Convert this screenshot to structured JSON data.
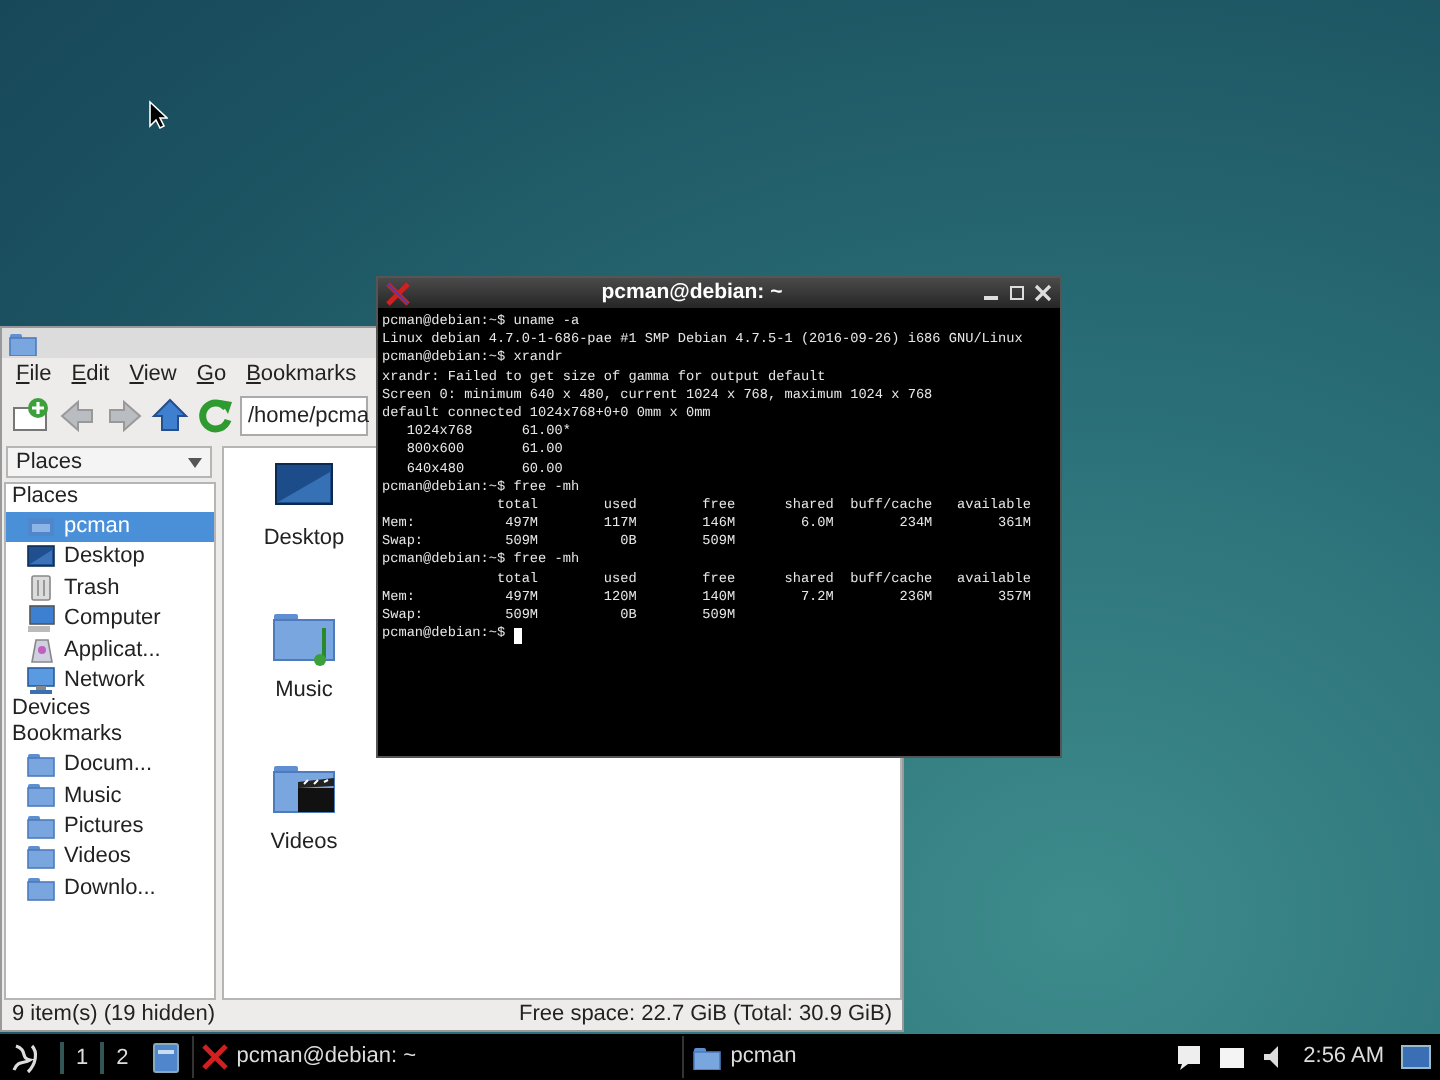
{
  "file_manager": {
    "menu": [
      "File",
      "Edit",
      "View",
      "Go",
      "Bookmarks"
    ],
    "path": "/home/pcma",
    "pane_mode": "Places",
    "sidebar": [
      {
        "label": "Places",
        "items": [
          {
            "label": "pcman",
            "selected": true
          },
          {
            "label": "Desktop",
            "selected": false
          },
          {
            "label": "Trash",
            "selected": false
          },
          {
            "label": "Computer",
            "selected": false
          },
          {
            "label": "Applicat...",
            "selected": false
          },
          {
            "label": "Network",
            "selected": false
          }
        ]
      },
      {
        "label": "Devices"
      },
      {
        "label": "Bookmarks",
        "items": [
          {
            "label": "Docum...",
            "selected": false
          },
          {
            "label": "Music",
            "selected": false
          },
          {
            "label": "Pictures",
            "selected": false
          },
          {
            "label": "Videos",
            "selected": false
          },
          {
            "label": "Downlo...",
            "selected": false
          }
        ]
      }
    ],
    "files": [
      {
        "label": "Desktop"
      },
      {
        "label": "Music"
      },
      {
        "label": "Videos"
      }
    ],
    "status_left": "9 item(s) (19 hidden)",
    "status_right": "Free space: 22.7 GiB (Total: 30.9 GiB)"
  },
  "terminal": {
    "title": "pcman@debian: ~",
    "lines": [
      "pcman@debian:~$ uname -a",
      "Linux debian 4.7.0-1-686-pae #1 SMP Debian 4.7.5-1 (2016-09-26) i686 GNU/Linux",
      "pcman@debian:~$ xrandr",
      "xrandr: Failed to get size of gamma for output default",
      "Screen 0: minimum 640 x 480, current 1024 x 768, maximum 1024 x 768",
      "default connected 1024x768+0+0 0mm x 0mm",
      "   1024x768      61.00*",
      "   800x600       61.00",
      "   640x480       60.00",
      "pcman@debian:~$ free -mh",
      "              total        used        free      shared  buff/cache   available",
      "Mem:           497M        117M        146M        6.0M        234M        361M",
      "Swap:          509M          0B        509M",
      "pcman@debian:~$ free -mh",
      "              total        used        free      shared  buff/cache   available",
      "Mem:           497M        120M        140M        7.2M        236M        357M",
      "Swap:          509M          0B        509M",
      "pcman@debian:~$ "
    ]
  },
  "taskbar": {
    "desktops": [
      "1",
      "2"
    ],
    "tasks": [
      {
        "label": "pcman@debian: ~"
      },
      {
        "label": "pcman"
      }
    ],
    "clock": "2:56 AM"
  }
}
